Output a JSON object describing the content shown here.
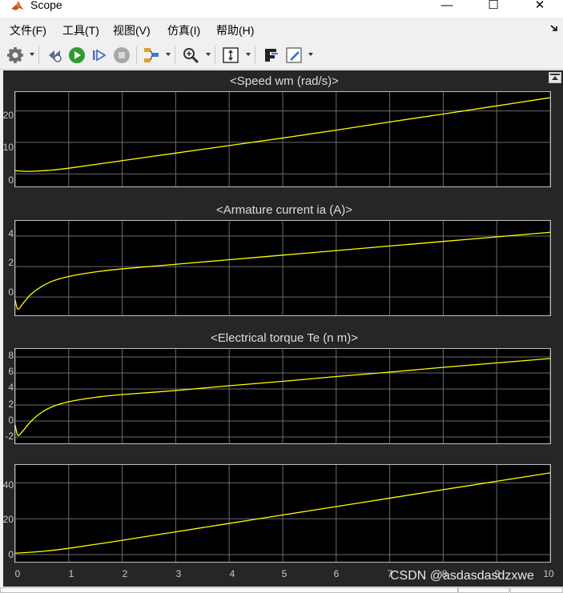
{
  "window": {
    "title": "Scope",
    "controls": {
      "minimize": "—",
      "maximize": "☐",
      "close": "✕"
    }
  },
  "menu": {
    "items": [
      {
        "label": "文件(F)"
      },
      {
        "label": "工具(T)"
      },
      {
        "label": "视图(V)"
      },
      {
        "label": "仿真(I)"
      },
      {
        "label": "帮助(H)"
      }
    ]
  },
  "toolbar": {
    "icons": [
      "gear-icon",
      "step-back-icon",
      "run-icon",
      "step-forward-icon",
      "stop-icon",
      "signal-selector-icon",
      "zoom-icon",
      "autoscale-icon",
      "highlight-icon",
      "style-icon"
    ],
    "colors": {
      "run": "#2e9b2e",
      "stop": "#a8a8a8"
    }
  },
  "scope": {
    "background": "#262626",
    "axes_background": "#000000",
    "grid_color": "#6b6b6b",
    "line_color": "#ffff00",
    "x_ticks": [
      "0",
      "1",
      "2",
      "3",
      "4",
      "5",
      "6",
      "7",
      "8",
      "9",
      "10"
    ],
    "plots": [
      {
        "title": "<Speed wm (rad/s)>",
        "y_ticks": [
          "20",
          "10",
          "0"
        ]
      },
      {
        "title": "<Armature current ia (A)>",
        "y_ticks": [
          "4",
          "2",
          "0"
        ]
      },
      {
        "title": "<Electrical torque Te (n m)>",
        "y_ticks": [
          "8",
          "6",
          "4",
          "2",
          "0",
          "-2"
        ]
      },
      {
        "title": "",
        "y_ticks": [
          "40",
          "20",
          "0"
        ]
      }
    ]
  },
  "chart_data": [
    {
      "type": "line",
      "title": "<Speed wm (rad/s)>",
      "xlim": [
        0,
        10
      ],
      "ylim": [
        -4,
        26
      ],
      "x": [
        0,
        0.2,
        0.4,
        0.6,
        1,
        2,
        3,
        4,
        5,
        6,
        7,
        8,
        9,
        10
      ],
      "y": [
        1.0,
        0.8,
        0.9,
        1.1,
        1.8,
        4.2,
        6.6,
        9.0,
        11.4,
        13.9,
        16.5,
        19.0,
        21.6,
        24.2
      ]
    },
    {
      "type": "line",
      "title": "<Armature current ia (A)>",
      "xlim": [
        0,
        10
      ],
      "ylim": [
        -1.2,
        5.0
      ],
      "x": [
        0,
        0.05,
        0.15,
        0.3,
        0.5,
        0.7,
        1,
        1.5,
        2,
        3,
        4,
        5,
        6,
        7,
        8,
        9,
        10
      ],
      "y": [
        -0.2,
        -0.8,
        -0.4,
        0.2,
        0.7,
        1.05,
        1.35,
        1.65,
        1.85,
        2.15,
        2.45,
        2.75,
        3.05,
        3.35,
        3.65,
        3.95,
        4.25
      ]
    },
    {
      "type": "line",
      "title": "<Electrical torque Te (n m)>",
      "xlim": [
        0,
        10
      ],
      "ylim": [
        -2.8,
        9.0
      ],
      "x": [
        0,
        0.05,
        0.15,
        0.3,
        0.5,
        0.7,
        1,
        1.5,
        2,
        3,
        4,
        5,
        6,
        7,
        8,
        9,
        10
      ],
      "y": [
        -0.5,
        -1.8,
        -1.2,
        0.0,
        1.1,
        1.8,
        2.4,
        2.95,
        3.3,
        3.8,
        4.4,
        4.95,
        5.55,
        6.1,
        6.7,
        7.25,
        7.8
      ]
    },
    {
      "type": "line",
      "title": "",
      "xlim": [
        0,
        10
      ],
      "ylim": [
        -4,
        50
      ],
      "x": [
        0,
        0.5,
        1,
        2,
        3,
        4,
        5,
        6,
        7,
        8,
        9,
        10
      ],
      "y": [
        0.8,
        1.8,
        3.5,
        8.0,
        12.7,
        17.4,
        22.1,
        26.8,
        31.5,
        36.2,
        40.9,
        45.6
      ]
    }
  ],
  "watermark": "CSDN @asdasdasdzxwe"
}
